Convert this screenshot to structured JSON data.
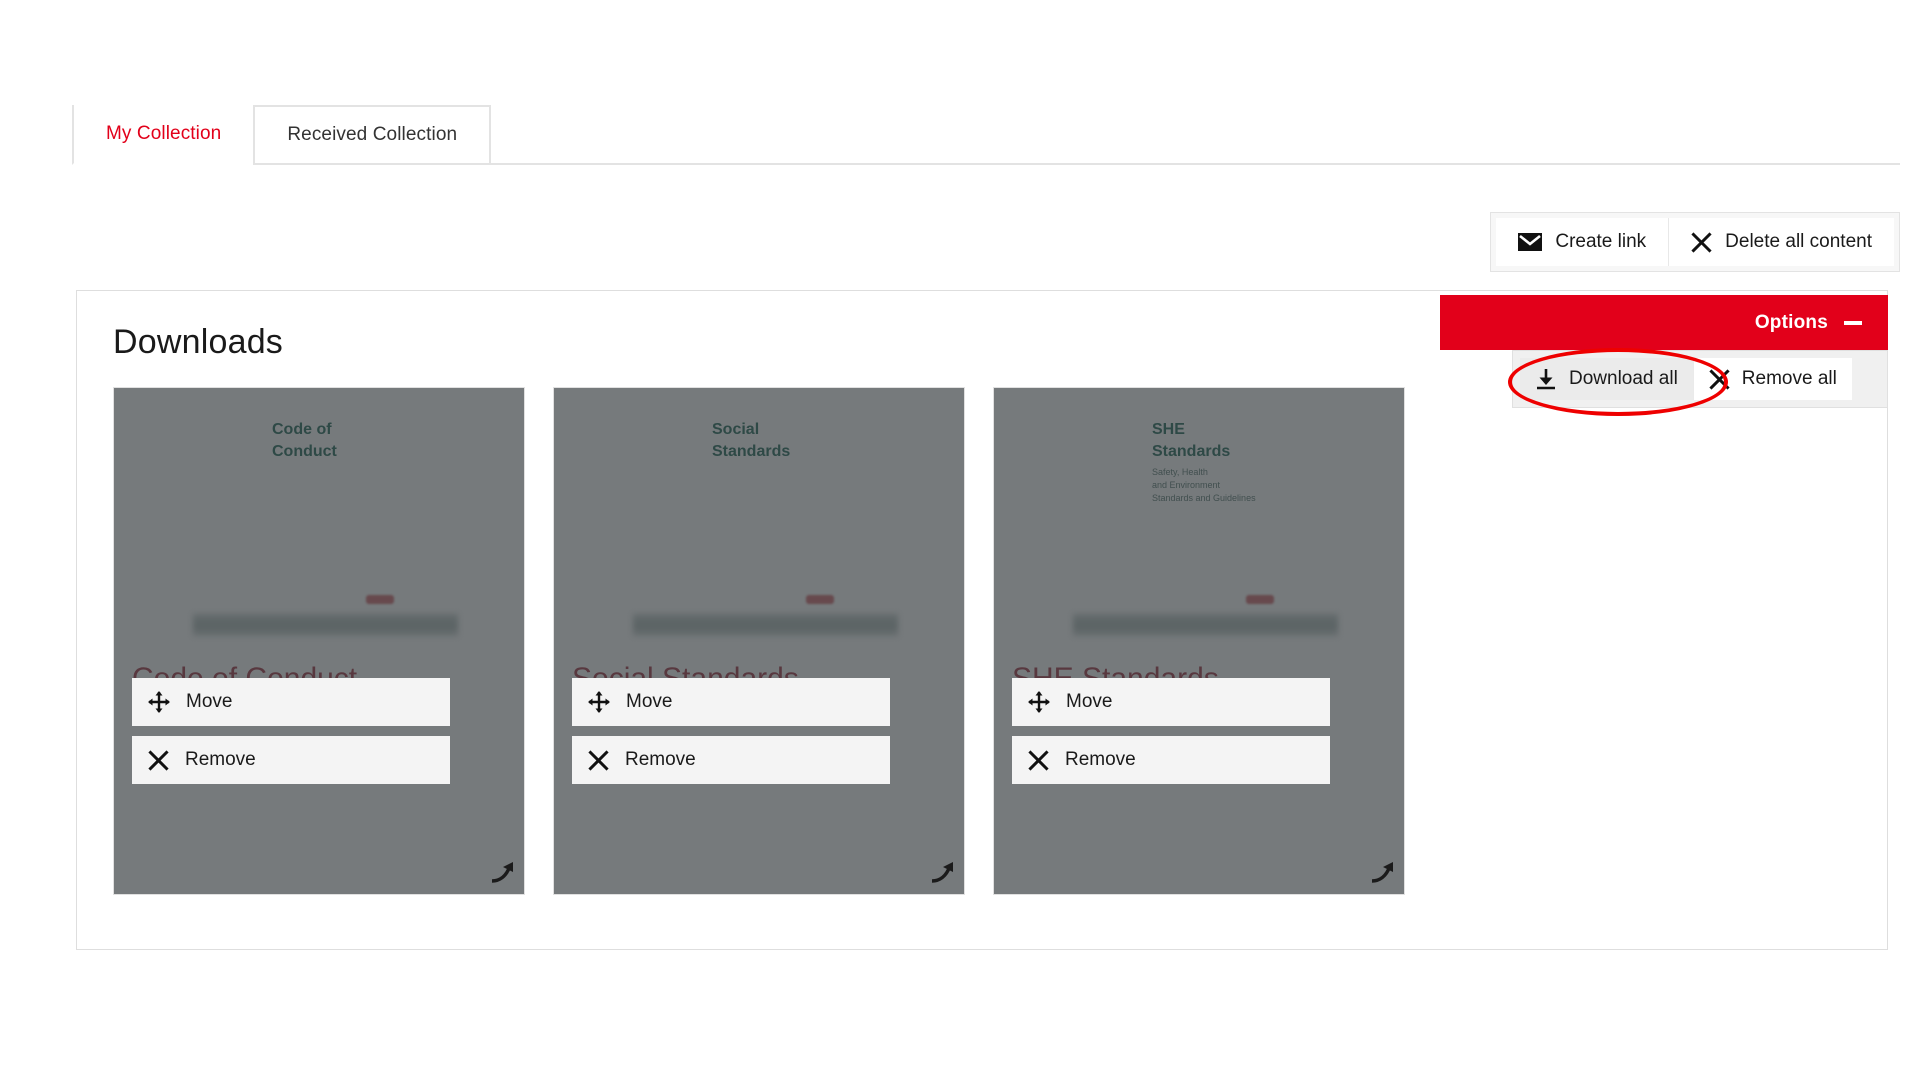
{
  "tabs": [
    {
      "label": "My Collection",
      "active": true
    },
    {
      "label": "Received Collection",
      "active": false
    }
  ],
  "top_actions": [
    {
      "label": "Create link",
      "icon": "envelope-icon"
    },
    {
      "label": "Delete all content",
      "icon": "close-x-icon"
    }
  ],
  "panel": {
    "title": "Downloads"
  },
  "options": {
    "label": "Options",
    "toggle_icon": "minus-icon",
    "menu": [
      {
        "label": "Download all",
        "icon": "download-icon",
        "highlighted": true
      },
      {
        "label": "Remove all",
        "icon": "close-x-icon",
        "highlighted": false
      }
    ]
  },
  "card_actions": {
    "move": "Move",
    "remove": "Remove",
    "expand_icon": "expand-arrow-icon",
    "move_icon": "move-arrows-icon",
    "remove_icon": "close-x-icon"
  },
  "cards": [
    {
      "caption": "Code of Conduct",
      "doc_title": "Code of\nConduct",
      "doc_subtitle": ""
    },
    {
      "caption": "Social Standards",
      "doc_title": "Social\nStandards",
      "doc_subtitle": ""
    },
    {
      "caption": "SHE Standards",
      "doc_title": "SHE\nStandards",
      "doc_subtitle": "Safety, Health\nand Environment\nStandards and Guidelines"
    }
  ],
  "colors": {
    "brand_red": "#e2001a",
    "annotation_red": "#ee0000",
    "caption_red": "#9b2233",
    "doc_green": "#0e5b4c",
    "overlay": "rgba(60,66,69,.70)"
  }
}
